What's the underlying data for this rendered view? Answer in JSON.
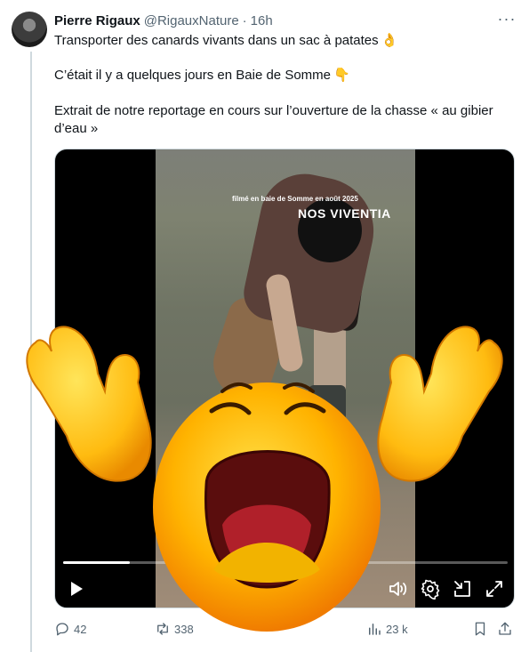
{
  "author": {
    "name": "Pierre Rigaux",
    "handle": "@RigauxNature",
    "separator": "·",
    "time": "16h",
    "avatar_icon": "avatar-photo"
  },
  "more_menu": {
    "label": "···",
    "icon": "more-horizontal-icon"
  },
  "tweet": {
    "line1": "Transporter des canards vivants dans un sac à patates",
    "line1_emoji": "👌",
    "line2": "C’était il y a quelques jours en Baie de Somme",
    "line2_emoji": "👇",
    "line3a": "Extrait de notre reportage en cours sur l’ouverture de la chasse « au gibier",
    "line3b": "d’eau »"
  },
  "video": {
    "caption_small": "filmé en baie de Somme en août 2025",
    "caption_brand": "NOS VIVENTIA",
    "progress": 0.15,
    "controls": [
      "play-icon",
      "volume-icon",
      "settings-icon",
      "exit-fullscreen-icon",
      "fullscreen-icon"
    ]
  },
  "actions": {
    "replies": "42",
    "reposts": "338",
    "views": "23 k",
    "icons": [
      "reply-icon",
      "repost-icon",
      "views-icon",
      "bookmark-icon",
      "share-icon"
    ]
  },
  "overlay": {
    "icon": "crying-face-emoji-with-hands"
  },
  "colors": {
    "text": "#0f1419",
    "secondary": "#536471",
    "border": "#cfd9de"
  }
}
